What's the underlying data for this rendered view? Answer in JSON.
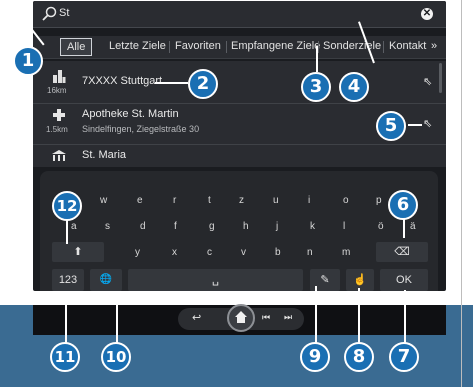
{
  "search": {
    "query": "St",
    "clear_icon": "close-circle-icon",
    "search_icon": "magnifier-icon"
  },
  "tabs": [
    {
      "label": "Alle",
      "selected": true
    },
    {
      "label": "Letzte Ziele"
    },
    {
      "label": "Favoriten"
    },
    {
      "label": "Empfangene Ziele"
    },
    {
      "label": "Sonderziele"
    },
    {
      "label": "Kontakt"
    },
    {
      "label": "»"
    }
  ],
  "results": [
    {
      "icon": "city-icon",
      "distance": "16km",
      "title": "7XXXX Stuttgart",
      "subtitle": ""
    },
    {
      "icon": "pharmacy-cross-icon",
      "distance": "1.5km",
      "title": "Apotheke St. Martin",
      "subtitle": "Sindelfingen, Ziegelstraße 30"
    },
    {
      "icon": "church-icon",
      "distance": "",
      "title": "St. Maria",
      "subtitle": ""
    }
  ],
  "keyboard": {
    "row1": [
      "w",
      "e",
      "r",
      "t",
      "z",
      "u",
      "i",
      "o",
      "p"
    ],
    "row2": [
      "a",
      "s",
      "d",
      "f",
      "g",
      "h",
      "j",
      "k",
      "l",
      "ö",
      "ä"
    ],
    "row3": [
      "y",
      "x",
      "c",
      "v",
      "b",
      "n",
      "m"
    ],
    "shift": "⬆",
    "backspace": "⌫",
    "numbers": "123",
    "language": "🌐",
    "space": "␣",
    "ok": "OK"
  },
  "callouts": [
    "1",
    "2",
    "3",
    "4",
    "5",
    "6",
    "7",
    "8",
    "9",
    "10",
    "11",
    "12"
  ],
  "colors": {
    "callout": "#1a6fb3",
    "panel": "#1a1c20",
    "keyboard": "#26282c"
  }
}
